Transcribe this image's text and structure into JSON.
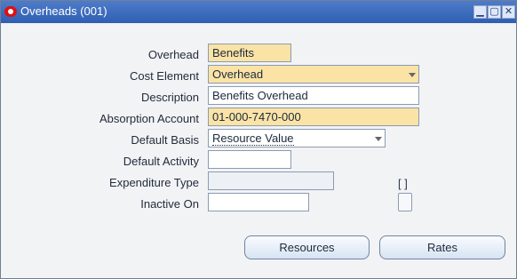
{
  "window": {
    "title": "Overheads (001)",
    "controls": {
      "minimize_icon": "minimize-icon",
      "maximize_icon": "maximize-icon",
      "close_icon": "close-icon"
    }
  },
  "form": {
    "labels": {
      "overhead": "Overhead",
      "cost_element": "Cost Element",
      "description": "Description",
      "absorption_account": "Absorption Account",
      "default_basis": "Default Basis",
      "default_activity": "Default Activity",
      "expenditure_type": "Expenditure Type",
      "inactive_on": "Inactive On"
    },
    "values": {
      "overhead": "Benefits",
      "cost_element": "Overhead",
      "description": "Benefits Overhead",
      "absorption_account": "01-000-7470-000",
      "default_basis": "Resource Value",
      "default_activity": "",
      "expenditure_type": "",
      "inactive_on": ""
    },
    "checkbox_mark": "[ ]"
  },
  "buttons": {
    "resources": "Resources",
    "rates": "Rates"
  },
  "colors": {
    "title_bar": "#2f5fb3",
    "required_field": "#fbe3a6",
    "window_bg": "#f2f3f5"
  }
}
